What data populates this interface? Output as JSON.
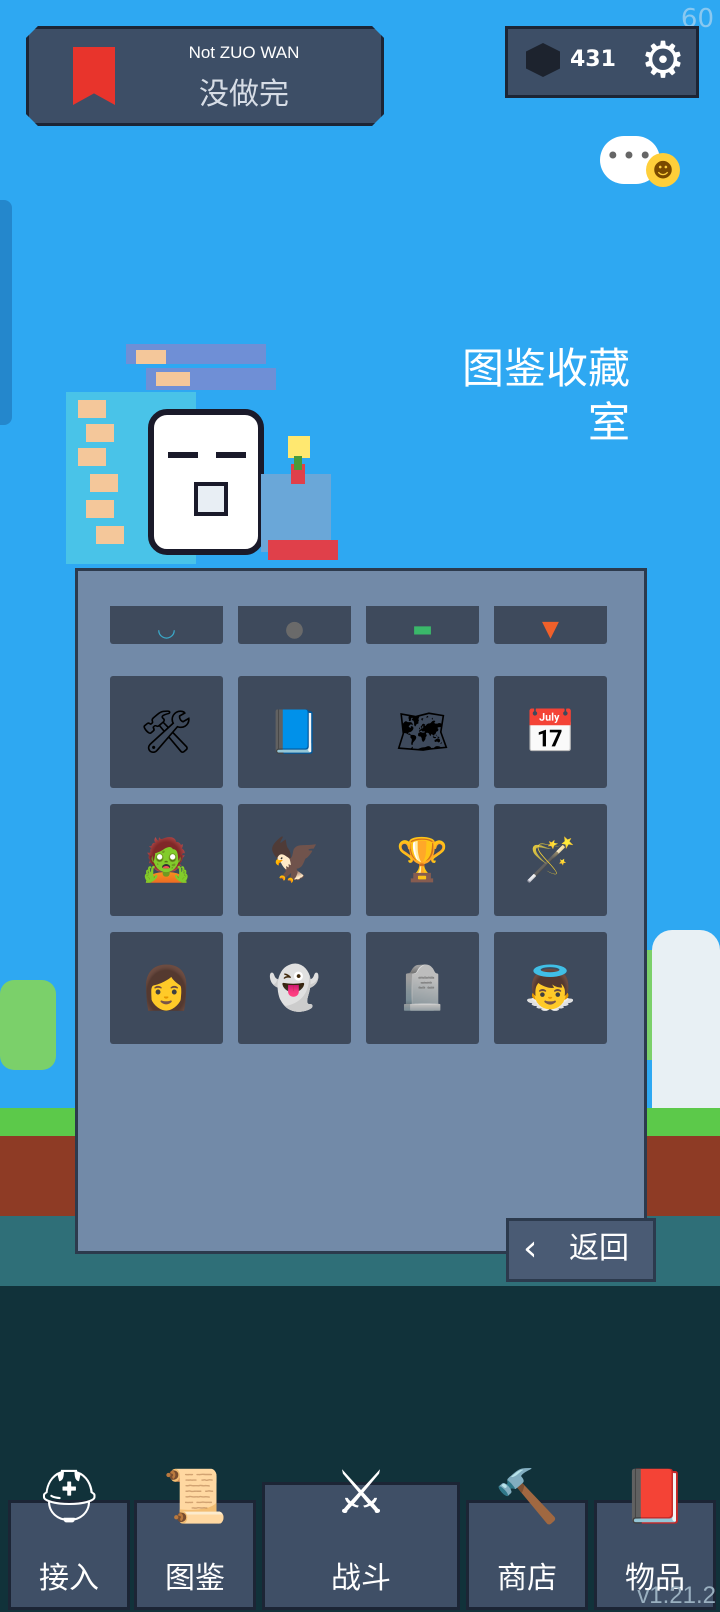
{
  "fps": "60",
  "header": {
    "title_en": "Not ZUO WAN",
    "title_cn": "没做完",
    "gem_count": "431"
  },
  "room_title": "图鉴收藏室",
  "collection": {
    "rows": [
      [
        "partial-blue-item",
        "partial-gray-item",
        "partial-green-item",
        "partial-orange-item"
      ],
      [
        "tools-icon",
        "holy-book-icon",
        "map-icon",
        "calendar-heart-icon"
      ],
      [
        "zombie-icon",
        "hawk-icon",
        "goblet-icon",
        "magic-wand-icon"
      ],
      [
        "hooded-woman-icon",
        "ghosts-icon",
        "tombstone-icon",
        "angel-icon"
      ]
    ]
  },
  "back_button": {
    "label": "返回"
  },
  "nav": {
    "items": [
      {
        "label": "接入",
        "icon": "helmet-icon"
      },
      {
        "label": "图鉴",
        "icon": "scroll-icon"
      },
      {
        "label": "战斗",
        "icon": "crossed-swords-icon"
      },
      {
        "label": "商店",
        "icon": "hammer-icon"
      },
      {
        "label": "物品",
        "icon": "spellbook-icon"
      }
    ]
  },
  "version": "v1.21.2",
  "colors": {
    "sky": "#2ea8f2",
    "panel": "#728aa8",
    "cell": "#3e4a5c"
  }
}
